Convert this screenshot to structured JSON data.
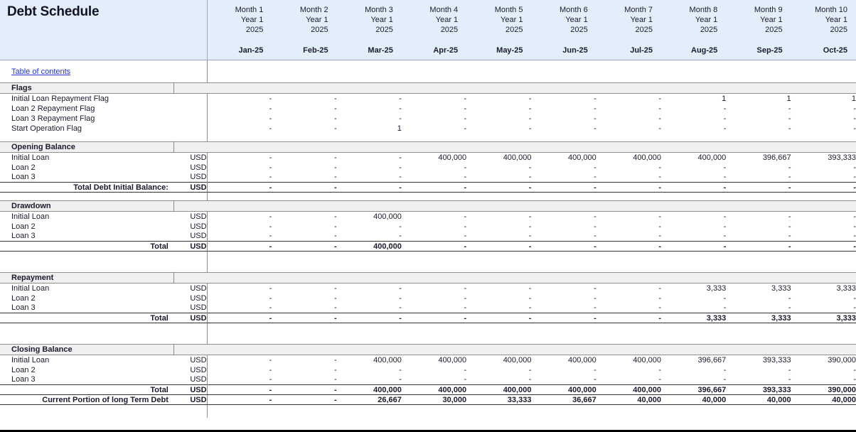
{
  "header": {
    "title": "Debt Schedule",
    "columns": [
      {
        "month": "Month 1",
        "year_label": "Year 1",
        "year": "2025",
        "date": "Jan-25"
      },
      {
        "month": "Month 2",
        "year_label": "Year 1",
        "year": "2025",
        "date": "Feb-25"
      },
      {
        "month": "Month 3",
        "year_label": "Year 1",
        "year": "2025",
        "date": "Mar-25"
      },
      {
        "month": "Month 4",
        "year_label": "Year 1",
        "year": "2025",
        "date": "Apr-25"
      },
      {
        "month": "Month 5",
        "year_label": "Year 1",
        "year": "2025",
        "date": "May-25"
      },
      {
        "month": "Month 6",
        "year_label": "Year 1",
        "year": "2025",
        "date": "Jun-25"
      },
      {
        "month": "Month 7",
        "year_label": "Year 1",
        "year": "2025",
        "date": "Jul-25"
      },
      {
        "month": "Month 8",
        "year_label": "Year 1",
        "year": "2025",
        "date": "Aug-25"
      },
      {
        "month": "Month 9",
        "year_label": "Year 1",
        "year": "2025",
        "date": "Sep-25"
      },
      {
        "month": "Month 10",
        "year_label": "Year 1",
        "year": "2025",
        "date": "Oct-25"
      }
    ]
  },
  "nav": {
    "table_of_contents": "Table of contents"
  },
  "units": {
    "usd": "USD"
  },
  "sections": {
    "flags": {
      "title": "Flags",
      "rows": [
        {
          "label": "Initial Loan Repayment Flag",
          "unit": "",
          "values": [
            "-",
            "-",
            "-",
            "-",
            "-",
            "-",
            "-",
            "1",
            "1",
            "1"
          ]
        },
        {
          "label": "Loan 2 Repayment Flag",
          "unit": "",
          "values": [
            "-",
            "-",
            "-",
            "-",
            "-",
            "-",
            "-",
            "-",
            "-",
            "-"
          ]
        },
        {
          "label": "Loan 3 Repayment Flag",
          "unit": "",
          "values": [
            "-",
            "-",
            "-",
            "-",
            "-",
            "-",
            "-",
            "-",
            "-",
            "-"
          ]
        },
        {
          "label": "Start Operation Flag",
          "unit": "",
          "values": [
            "-",
            "-",
            "1",
            "-",
            "-",
            "-",
            "-",
            "-",
            "-",
            "-"
          ]
        }
      ]
    },
    "opening_balance": {
      "title": "Opening Balance",
      "rows": [
        {
          "label": "Initial Loan",
          "unit": "USD",
          "values": [
            "-",
            "-",
            "-",
            "400,000",
            "400,000",
            "400,000",
            "400,000",
            "400,000",
            "396,667",
            "393,333"
          ]
        },
        {
          "label": "Loan 2",
          "unit": "USD",
          "values": [
            "-",
            "-",
            "-",
            "-",
            "-",
            "-",
            "-",
            "-",
            "-",
            "-"
          ]
        },
        {
          "label": "Loan 3",
          "unit": "USD",
          "values": [
            "-",
            "-",
            "-",
            "-",
            "-",
            "-",
            "-",
            "-",
            "-",
            "-"
          ]
        }
      ],
      "total": {
        "label": "Total Debt Initial Balance:",
        "unit": "USD",
        "values": [
          "-",
          "-",
          "-",
          "-",
          "-",
          "-",
          "-",
          "-",
          "-",
          "-"
        ]
      }
    },
    "drawdown": {
      "title": "Drawdown",
      "rows": [
        {
          "label": "Initial Loan",
          "unit": "USD",
          "values": [
            "-",
            "-",
            "400,000",
            "-",
            "-",
            "-",
            "-",
            "-",
            "-",
            "-"
          ]
        },
        {
          "label": "Loan 2",
          "unit": "USD",
          "values": [
            "-",
            "-",
            "-",
            "-",
            "-",
            "-",
            "-",
            "-",
            "-",
            "-"
          ]
        },
        {
          "label": "Loan 3",
          "unit": "USD",
          "values": [
            "-",
            "-",
            "-",
            "-",
            "-",
            "-",
            "-",
            "-",
            "-",
            "-"
          ]
        }
      ],
      "total": {
        "label": "Total",
        "unit": "USD",
        "values": [
          "-",
          "-",
          "400,000",
          "-",
          "-",
          "-",
          "-",
          "-",
          "-",
          "-"
        ]
      }
    },
    "repayment": {
      "title": "Repayment",
      "rows": [
        {
          "label": "Initial Loan",
          "unit": "USD",
          "values": [
            "-",
            "-",
            "-",
            "-",
            "-",
            "-",
            "-",
            "3,333",
            "3,333",
            "3,333"
          ]
        },
        {
          "label": "Loan 2",
          "unit": "USD",
          "values": [
            "-",
            "-",
            "-",
            "-",
            "-",
            "-",
            "-",
            "-",
            "-",
            "-"
          ]
        },
        {
          "label": "Loan 3",
          "unit": "USD",
          "values": [
            "-",
            "-",
            "-",
            "-",
            "-",
            "-",
            "-",
            "-",
            "-",
            "-"
          ]
        }
      ],
      "total": {
        "label": "Total",
        "unit": "USD",
        "values": [
          "-",
          "-",
          "-",
          "-",
          "-",
          "-",
          "-",
          "3,333",
          "3,333",
          "3,333"
        ]
      }
    },
    "closing_balance": {
      "title": "Closing Balance",
      "rows": [
        {
          "label": "Initial Loan",
          "unit": "USD",
          "values": [
            "-",
            "-",
            "400,000",
            "400,000",
            "400,000",
            "400,000",
            "400,000",
            "396,667",
            "393,333",
            "390,000"
          ]
        },
        {
          "label": "Loan 2",
          "unit": "USD",
          "values": [
            "-",
            "-",
            "-",
            "-",
            "-",
            "-",
            "-",
            "-",
            "-",
            "-"
          ]
        },
        {
          "label": "Loan 3",
          "unit": "USD",
          "values": [
            "-",
            "-",
            "-",
            "-",
            "-",
            "-",
            "-",
            "-",
            "-",
            "-"
          ]
        }
      ],
      "total": {
        "label": "Total",
        "unit": "USD",
        "values": [
          "-",
          "-",
          "400,000",
          "400,000",
          "400,000",
          "400,000",
          "400,000",
          "396,667",
          "393,333",
          "390,000"
        ]
      },
      "current_portion": {
        "label": "Current Portion of long Term Debt",
        "unit": "USD",
        "values": [
          "-",
          "-",
          "26,667",
          "30,000",
          "33,333",
          "36,667",
          "40,000",
          "40,000",
          "40,000",
          "40,000"
        ]
      }
    }
  },
  "colors": {
    "header_background": "#e3eefb",
    "section_background": "#f0f0f0",
    "link": "#2233cc",
    "grid_line": "#8c8c8c"
  }
}
